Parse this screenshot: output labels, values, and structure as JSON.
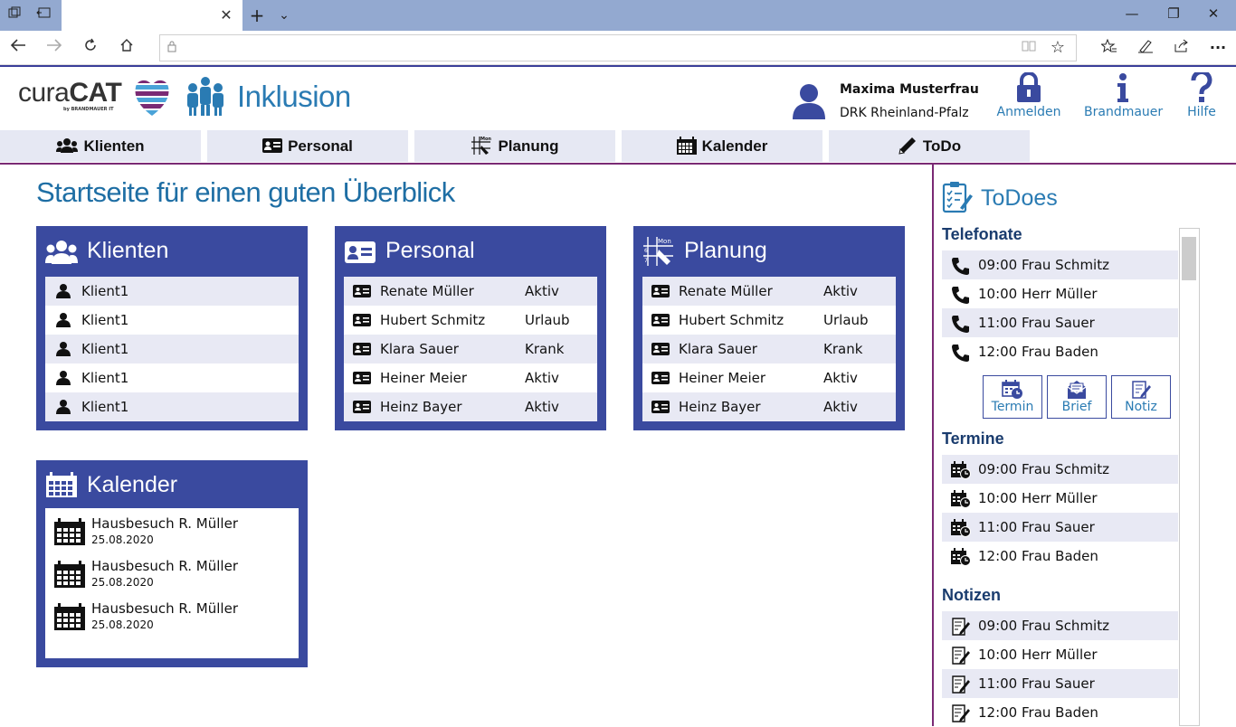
{
  "browser": {
    "tab_close": "✕",
    "new_tab": "+",
    "tab_menu": "⌄",
    "win_min": "—",
    "win_restore": "❐",
    "win_close": "✕",
    "url": ""
  },
  "header": {
    "logo_text_a": "cura",
    "logo_text_b": "CAT",
    "logo_sub": "by BRANDMAUER IT",
    "app_title": "Inklusion",
    "user_name": "Maxima Musterfrau",
    "user_org": "DRK Rheinland-Pfalz",
    "buttons": [
      {
        "label": "Anmelden",
        "icon": "lock-icon"
      },
      {
        "label": "Brandmauer",
        "icon": "info-icon"
      },
      {
        "label": "Hilfe",
        "icon": "help-icon"
      }
    ]
  },
  "nav": {
    "tabs": [
      {
        "label": "Klienten",
        "icon": "users-icon"
      },
      {
        "label": "Personal",
        "icon": "id-card-icon"
      },
      {
        "label": "Planung",
        "icon": "planning-icon"
      },
      {
        "label": "Kalender",
        "icon": "calendar-icon"
      },
      {
        "label": "ToDo",
        "icon": "pencil-icon"
      }
    ]
  },
  "main": {
    "title": "Startseite für einen guten Überblick",
    "cards": {
      "klienten": {
        "title": "Klienten",
        "rows": [
          "Klient1",
          "Klient1",
          "Klient1",
          "Klient1",
          "Klient1"
        ]
      },
      "personal": {
        "title": "Personal",
        "rows": [
          {
            "name": "Renate Müller",
            "status": "Aktiv"
          },
          {
            "name": "Hubert Schmitz",
            "status": "Urlaub"
          },
          {
            "name": "Klara Sauer",
            "status": "Krank"
          },
          {
            "name": "Heiner Meier",
            "status": "Aktiv"
          },
          {
            "name": "Heinz Bayer",
            "status": "Aktiv"
          }
        ]
      },
      "planung": {
        "title": "Planung",
        "icon_label": "Mon",
        "rows": [
          {
            "name": "Renate Müller",
            "status": "Aktiv"
          },
          {
            "name": "Hubert Schmitz",
            "status": "Urlaub"
          },
          {
            "name": "Klara Sauer",
            "status": "Krank"
          },
          {
            "name": "Heiner Meier",
            "status": "Aktiv"
          },
          {
            "name": "Heinz Bayer",
            "status": "Aktiv"
          }
        ]
      },
      "kalender": {
        "title": "Kalender",
        "items": [
          {
            "title": "Hausbesuch R. Müller",
            "date": "25.08.2020"
          },
          {
            "title": "Hausbesuch R. Müller",
            "date": "25.08.2020"
          },
          {
            "title": "Hausbesuch R. Müller",
            "date": "25.08.2020"
          }
        ]
      }
    }
  },
  "sidebar": {
    "title": "ToDoes",
    "telefonate": {
      "heading": "Telefonate",
      "items": [
        "09:00 Frau Schmitz",
        "10:00 Herr Müller",
        "11:00 Frau Sauer",
        "12:00 Frau Baden"
      ]
    },
    "actions": [
      {
        "label": "Termin",
        "icon": "calendar-clock-icon"
      },
      {
        "label": "Brief",
        "icon": "envelope-icon"
      },
      {
        "label": "Notiz",
        "icon": "note-icon"
      }
    ],
    "termine": {
      "heading": "Termine",
      "items": [
        "09:00 Frau Schmitz",
        "10:00 Herr Müller",
        "11:00 Frau Sauer",
        "12:00 Frau Baden"
      ]
    },
    "notizen": {
      "heading": "Notizen",
      "items": [
        "09:00 Frau Schmitz",
        "10:00 Herr Müller",
        "11:00 Frau Sauer",
        "12:00 Frau Baden"
      ]
    }
  },
  "colors": {
    "brand_blue": "#3a4a9f",
    "accent_blue": "#2a7bb3",
    "row_alt": "#e8e9f4",
    "divider": "#7a2a74"
  }
}
